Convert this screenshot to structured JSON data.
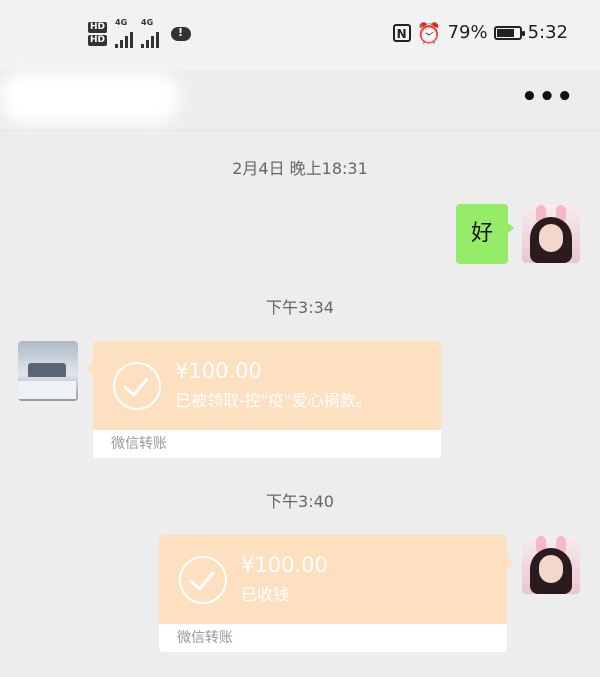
{
  "status_bar": {
    "hd1": "HD",
    "hd2": "HD",
    "net1": "4G",
    "net2": "4G",
    "battery_text": "79%",
    "time": "5:32",
    "battery_level": 0.79
  },
  "header": {
    "more_label": "•••"
  },
  "messages": [
    {
      "type": "timestamp",
      "text": "2月4日 晚上18:31"
    },
    {
      "type": "text",
      "side": "right",
      "text": "好"
    },
    {
      "type": "timestamp",
      "text": "下午3:34"
    },
    {
      "type": "transfer",
      "side": "left",
      "amount": "¥100.00",
      "description": "已被领取-控\"疫\"爱心捐款。",
      "footer": "微信转账"
    },
    {
      "type": "timestamp",
      "text": "下午3:40"
    },
    {
      "type": "transfer",
      "side": "right",
      "amount": "¥100.00",
      "description": "已收钱",
      "footer": "微信转账"
    }
  ],
  "colors": {
    "background": "#ededed",
    "text_bubble": "#95ec69",
    "transfer_card": "#fce0c0"
  }
}
